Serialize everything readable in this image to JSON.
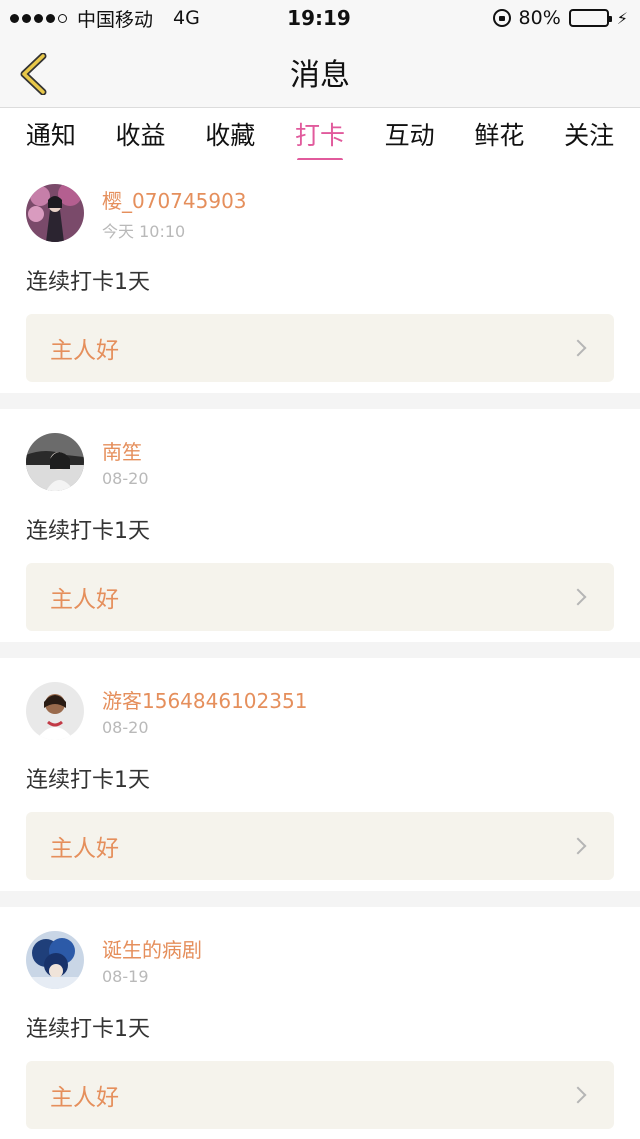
{
  "status_bar": {
    "carrier": "中国移动",
    "network": "4G",
    "time": "19:19",
    "battery": "80%",
    "battery_level": 0.8
  },
  "nav": {
    "title": "消息",
    "back_icon": "chevron-left-icon",
    "accent": "#e8c84a"
  },
  "tabs": [
    {
      "label": "通知",
      "active": false
    },
    {
      "label": "收益",
      "active": false
    },
    {
      "label": "收藏",
      "active": false
    },
    {
      "label": "打卡",
      "active": true
    },
    {
      "label": "互动",
      "active": false
    },
    {
      "label": "鲜花",
      "active": false
    },
    {
      "label": "关注",
      "active": false
    }
  ],
  "colors": {
    "active_tab": "#e15a9c",
    "username": "#e58f5c",
    "reply_bg": "#f5f3ec"
  },
  "messages": [
    {
      "name": "樱_070745903",
      "time": "今天 10:10",
      "text": "连续打卡1天",
      "reply": "主人好"
    },
    {
      "name": "南笙",
      "time": "08-20",
      "text": "连续打卡1天",
      "reply": "主人好"
    },
    {
      "name": "游客1564846102351",
      "time": "08-20",
      "text": "连续打卡1天",
      "reply": "主人好"
    },
    {
      "name": "诞生的病剧",
      "time": "08-19",
      "text": "连续打卡1天",
      "reply": "主人好"
    }
  ]
}
